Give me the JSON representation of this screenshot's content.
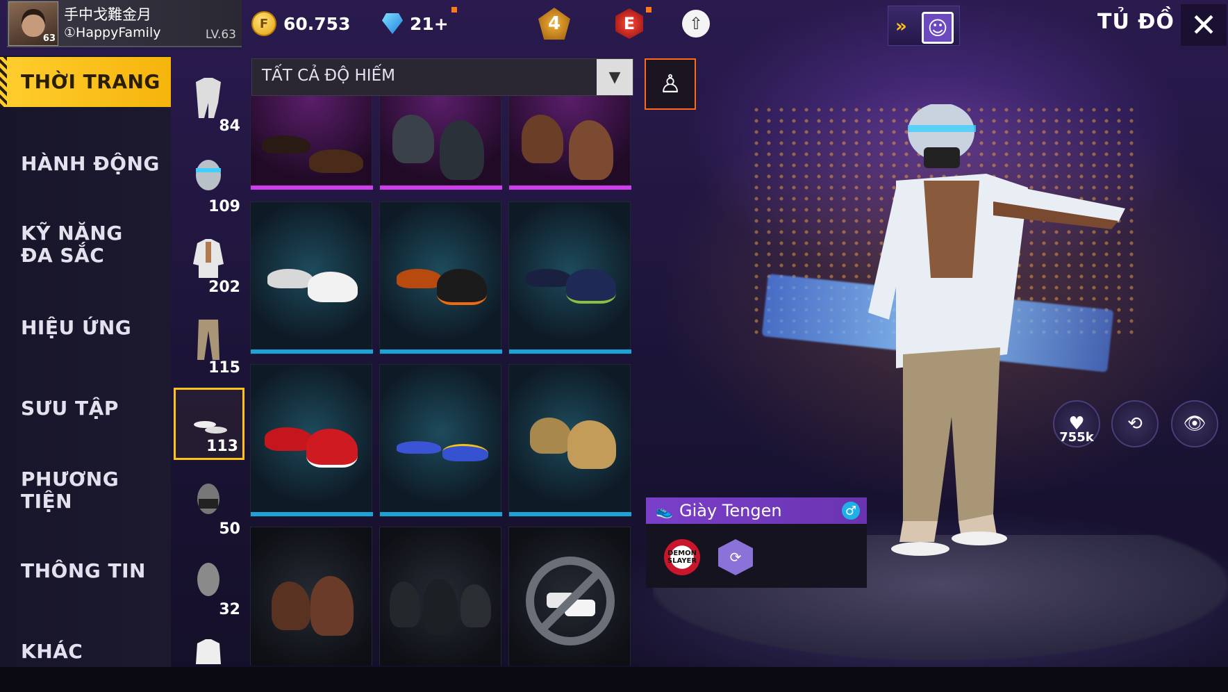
{
  "header": {
    "player_name": "手中戈難金月",
    "player_sub": "①HappyFamily",
    "avatar_level": "63",
    "level_label": "LV.63",
    "gold": "60.753",
    "diamonds": "21+",
    "rank_badge": "4",
    "elite_badge": "E",
    "page_title": "TỦ ĐỒ",
    "icons": {
      "gold": "gold-coin-icon",
      "diamond": "diamond-icon",
      "rank": "rank-badge-icon",
      "elite": "elite-pass-icon",
      "cloud": "cloud-upload-icon",
      "camera": "photo-mode-icon",
      "close": "close-icon"
    }
  },
  "left_menu": {
    "items": [
      {
        "label": "THỜI TRANG",
        "active": true
      },
      {
        "label": "HÀNH ĐỘNG",
        "active": false
      },
      {
        "label": "KỸ NĂNG ĐA SẮC",
        "active": false
      },
      {
        "label": "HIỆU ỨNG",
        "active": false
      },
      {
        "label": "SƯU TẬP",
        "active": false
      },
      {
        "label": "PHƯƠNG TIỆN",
        "active": false
      },
      {
        "label": "THÔNG TIN",
        "active": false
      },
      {
        "label": "KHÁC",
        "active": false
      }
    ]
  },
  "categories": [
    {
      "icon": "outfit-icon",
      "count": "84"
    },
    {
      "icon": "headgear-icon",
      "count": "109"
    },
    {
      "icon": "top-icon",
      "count": "202"
    },
    {
      "icon": "pants-icon",
      "count": "115"
    },
    {
      "icon": "shoes-icon",
      "count": "113",
      "active": true
    },
    {
      "icon": "mask-icon",
      "count": "50"
    },
    {
      "icon": "face-icon",
      "count": "32"
    },
    {
      "icon": "jacket-icon",
      "count": ""
    }
  ],
  "filter": {
    "label": "TẤT CẢ ĐỘ HIẾM"
  },
  "grid": {
    "tiles": [
      {
        "item": "brown-leather-shoes",
        "rarity": "purple"
      },
      {
        "item": "grey-combat-boots",
        "rarity": "purple"
      },
      {
        "item": "brown-cowboy-boots",
        "rarity": "purple"
      },
      {
        "item": "white-sneakers",
        "rarity": "blue"
      },
      {
        "item": "orange-black-sneakers",
        "rarity": "blue"
      },
      {
        "item": "navy-runners",
        "rarity": "blue"
      },
      {
        "item": "red-black-sneakers",
        "rarity": "blue"
      },
      {
        "item": "blue-flip-flops",
        "rarity": "blue"
      },
      {
        "item": "tan-high-tops",
        "rarity": "blue"
      },
      {
        "item": "brown-lace-up-boots",
        "rarity": "dark"
      },
      {
        "item": "black-combat-boots",
        "rarity": "dark"
      },
      {
        "item": "no-shoes",
        "rarity": "dark"
      }
    ]
  },
  "selected_item": {
    "name": "Giày Tengen",
    "tag1_text": "DEMON SLAYER",
    "tag2_icon": "collection-hex-icon",
    "gender_icon": "male-icon"
  },
  "actions": {
    "likes": "755k",
    "rotate_icon": "rotate-icon",
    "view_icon": "view-character-icon"
  },
  "colors": {
    "accent_yellow": "#ffc21a",
    "rarity_purple": "#d13cf0",
    "rarity_blue": "#1ca3d8",
    "item_banner": "#7a3fc9"
  }
}
